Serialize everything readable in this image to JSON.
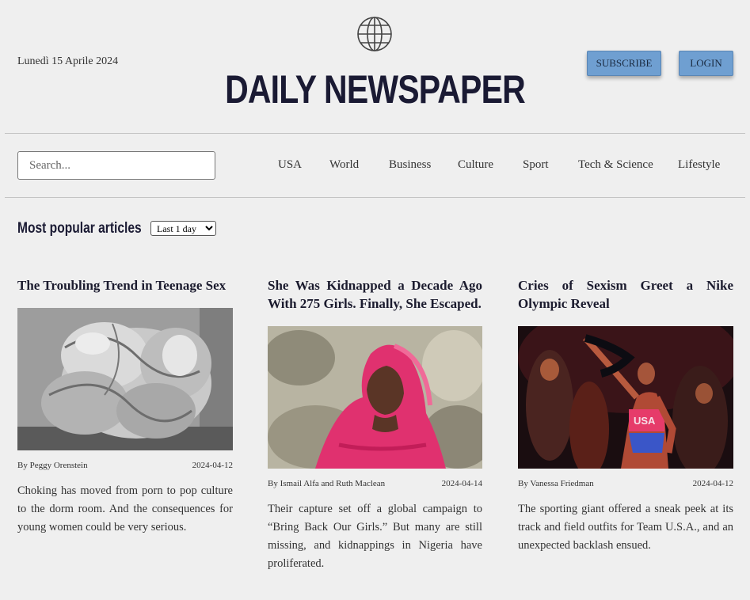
{
  "header": {
    "date": "Lunedì 15 Aprile 2024",
    "title": "DAILY NEWSPAPER",
    "subscribe_label": "SUBSCRIBE",
    "login_label": "LOGIN",
    "logo_icon": "globe-icon"
  },
  "search": {
    "placeholder": "Search..."
  },
  "nav": {
    "items": [
      "USA",
      "World",
      "Business",
      "Culture",
      "Sport",
      "Tech & Science",
      "Lifestyle"
    ]
  },
  "popular": {
    "heading": "Most popular articles",
    "period_selected": "Last 1 day"
  },
  "articles": [
    {
      "title": "The Troubling Trend in Teenage Sex",
      "author": "By Peggy Orenstein",
      "date": "2024-04-12",
      "excerpt": "Choking has moved from porn to pop culture to the dorm room. And the consequences for young women could be very serious."
    },
    {
      "title": "She Was Kidnapped a Decade Ago With 275 Girls. Finally, She Escaped.",
      "author": "By Ismail Alfa and Ruth Maclean",
      "date": "2024-04-14",
      "excerpt": "Their capture set off a global campaign to “Bring Back Our Girls.” But many are still missing, and kidnappings in Nigeria have proliferated."
    },
    {
      "title": "Cries of Sexism Greet a Nike Olympic Reveal",
      "author": "By Vanessa Friedman",
      "date": "2024-04-12",
      "excerpt": "The sporting giant offered a sneak peek at its track and field outfits for Team U.S.A., and an unexpected backlash ensued."
    }
  ],
  "colors": {
    "button_bg": "#6f9fd1",
    "masthead": "#1a1a33",
    "page_bg": "#efefef"
  }
}
